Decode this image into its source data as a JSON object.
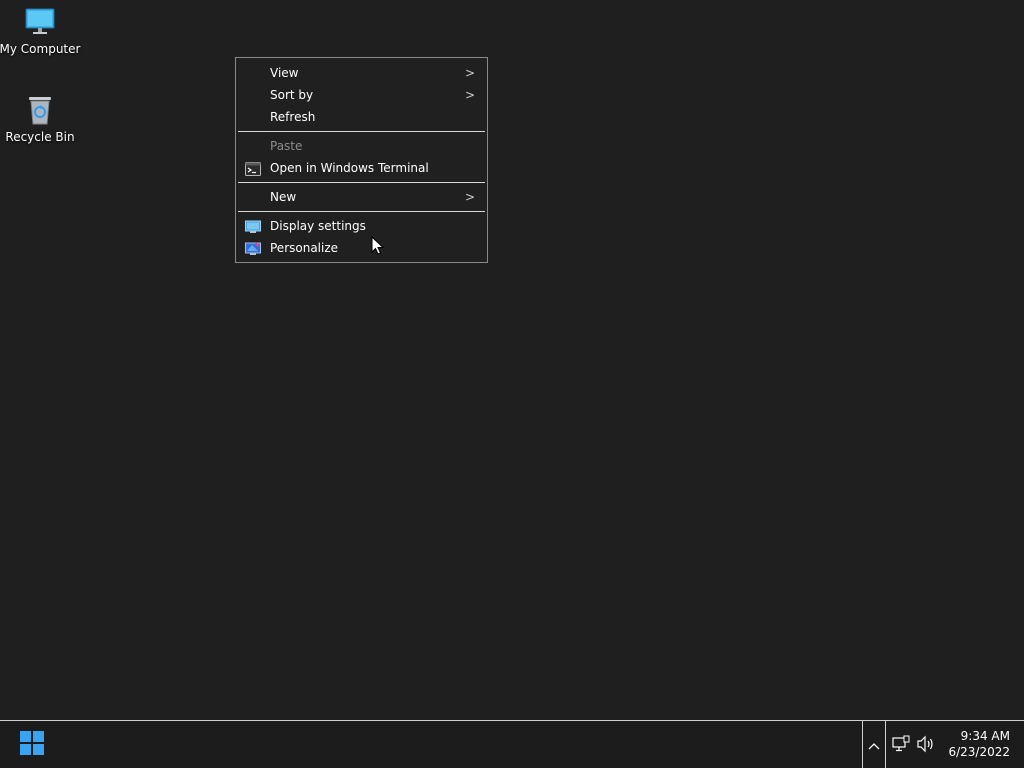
{
  "desktop": {
    "icons": [
      {
        "label": "My Computer",
        "icon": "monitor-icon"
      },
      {
        "label": "Recycle Bin",
        "icon": "recycle-bin-icon"
      }
    ]
  },
  "context_menu": {
    "items": [
      {
        "label": "View",
        "submenu": true
      },
      {
        "label": "Sort by",
        "submenu": true
      },
      {
        "label": "Refresh"
      },
      {
        "label": "Paste",
        "disabled": true
      },
      {
        "label": "Open in Windows Terminal",
        "icon": "terminal-icon"
      },
      {
        "label": "New",
        "submenu": true
      },
      {
        "label": "Display settings",
        "icon": "display-settings-icon"
      },
      {
        "label": "Personalize",
        "icon": "personalize-icon"
      }
    ],
    "submenu_arrow": ">"
  },
  "taskbar": {
    "start_icon": "windows-logo-icon",
    "tray_chevron": "^",
    "tray_icons": [
      "network-icon",
      "volume-icon"
    ],
    "clock": {
      "time": "9:34 AM",
      "date": "6/23/2022"
    }
  },
  "colors": {
    "desktop_bg": "#1f1f1f",
    "menu_bg": "#202020",
    "accent": "#2f9cf1"
  }
}
